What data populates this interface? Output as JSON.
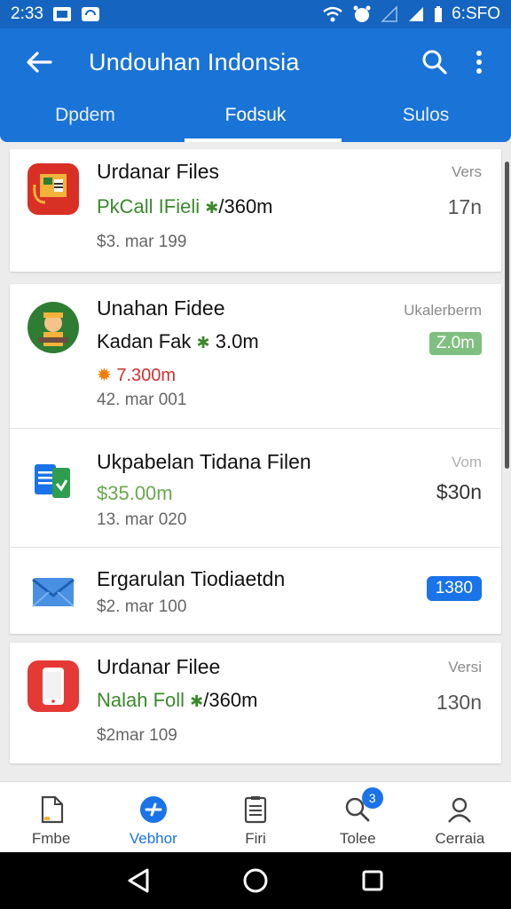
{
  "status_bar": {
    "time": "2:33",
    "clock_right": "6:SFO"
  },
  "app_bar": {
    "title": "Undouhan Indonsia"
  },
  "tabs": [
    {
      "label": "Dpdem",
      "active": false
    },
    {
      "label": "Fodsuk",
      "active": true
    },
    {
      "label": "Sulos",
      "active": false
    }
  ],
  "cards": {
    "c1": {
      "r1": {
        "icon": "file-folder-icon",
        "title": "Urdanar Files",
        "line2_a": "PkCall IFieli",
        "line2_b": "/360m",
        "meta": "$3. mar 199",
        "right_top": "Vers",
        "right_val": "17n"
      }
    },
    "c2": {
      "r1": {
        "icon": "avatar-app-icon",
        "title": "Unahan Fidee",
        "line2_a": "Kadan Fak",
        "line2_b": "3.0m",
        "extra": "7.300m",
        "meta": "42. mar 001",
        "right_top": "Ukalerberm",
        "badge": "Z.0m"
      },
      "r2": {
        "icon": "docs-app-icon",
        "title": "Ukpabelan Tidana Filen",
        "line2_a": "$35.00m",
        "meta": "13. mar 020",
        "right_top": "Vom",
        "right_val": "$30n"
      },
      "r3": {
        "icon": "mail-app-icon",
        "title": "Ergarulan Tiodiaetdn",
        "meta": "$2. mar 100",
        "badge": "1380"
      }
    },
    "c3": {
      "r1": {
        "icon": "phone-app-icon",
        "title": "Urdanar Filee",
        "line2_a": "Nalah Foll",
        "line2_b": "/360m",
        "meta": "$2mar 109",
        "right_top": "Versi",
        "right_val": "130n"
      }
    }
  },
  "bottom_nav": [
    {
      "label": "Fmbe",
      "icon": "document-icon",
      "active": false
    },
    {
      "label": "Vebhor",
      "icon": "download-circle-icon",
      "active": true
    },
    {
      "label": "Firi",
      "icon": "list-document-icon",
      "active": false
    },
    {
      "label": "Tolee",
      "icon": "search-icon",
      "active": false,
      "badge": "3"
    },
    {
      "label": "Cerraia",
      "icon": "person-icon",
      "active": false
    }
  ],
  "colors": {
    "primary": "#1a73d6",
    "status": "#1565c0",
    "green": "#3a8a2c",
    "red": "#d32f2f",
    "accent": "#1a73e8"
  }
}
